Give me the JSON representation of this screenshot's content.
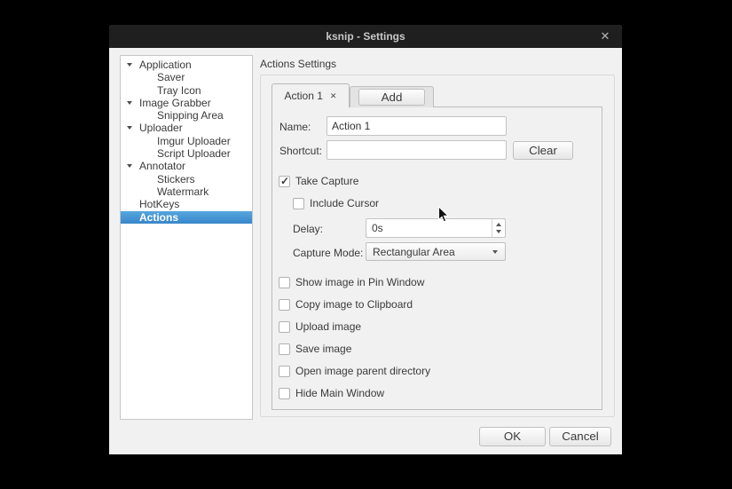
{
  "window": {
    "title": "ksnip - Settings",
    "close_glyph": "✕"
  },
  "sidebar": {
    "items": [
      {
        "label": "Application",
        "level": 0,
        "expanded": true,
        "selected": false
      },
      {
        "label": "Saver",
        "level": 1,
        "expanded": false,
        "selected": false
      },
      {
        "label": "Tray Icon",
        "level": 1,
        "expanded": false,
        "selected": false
      },
      {
        "label": "Image Grabber",
        "level": 0,
        "expanded": true,
        "selected": false
      },
      {
        "label": "Snipping Area",
        "level": 1,
        "expanded": false,
        "selected": false
      },
      {
        "label": "Uploader",
        "level": 0,
        "expanded": true,
        "selected": false
      },
      {
        "label": "Imgur Uploader",
        "level": 1,
        "expanded": false,
        "selected": false
      },
      {
        "label": "Script Uploader",
        "level": 1,
        "expanded": false,
        "selected": false
      },
      {
        "label": "Annotator",
        "level": 0,
        "expanded": true,
        "selected": false
      },
      {
        "label": "Stickers",
        "level": 1,
        "expanded": false,
        "selected": false
      },
      {
        "label": "Watermark",
        "level": 1,
        "expanded": false,
        "selected": false
      },
      {
        "label": "HotKeys",
        "level": 0,
        "expanded": false,
        "selected": false
      },
      {
        "label": "Actions",
        "level": 0,
        "expanded": false,
        "selected": true
      }
    ]
  },
  "content": {
    "heading": "Actions Settings",
    "tabs": {
      "active_label": "Action 1",
      "close_glyph": "✕",
      "add_label": "Add"
    },
    "form": {
      "name_label": "Name:",
      "name_value": "Action 1",
      "shortcut_label": "Shortcut:",
      "shortcut_value": "",
      "clear_label": "Clear",
      "take_capture": {
        "label": "Take Capture",
        "checked": true
      },
      "include_cursor": {
        "label": "Include Cursor",
        "checked": false
      },
      "delay_label": "Delay:",
      "delay_value": "0s",
      "capture_mode_label": "Capture Mode:",
      "capture_mode_value": "Rectangular Area",
      "options": [
        {
          "label": "Show image in Pin Window",
          "checked": false
        },
        {
          "label": "Copy image to Clipboard",
          "checked": false
        },
        {
          "label": "Upload image",
          "checked": false
        },
        {
          "label": "Save image",
          "checked": false
        },
        {
          "label": "Open image parent directory",
          "checked": false
        },
        {
          "label": "Hide Main Window",
          "checked": false
        }
      ]
    }
  },
  "footer": {
    "ok_label": "OK",
    "cancel_label": "Cancel"
  },
  "colors": {
    "titlebar_bg": "#1f1f1f",
    "window_bg": "#f1f1f1",
    "selection_top": "#55a6de",
    "selection_bottom": "#3886c9"
  }
}
